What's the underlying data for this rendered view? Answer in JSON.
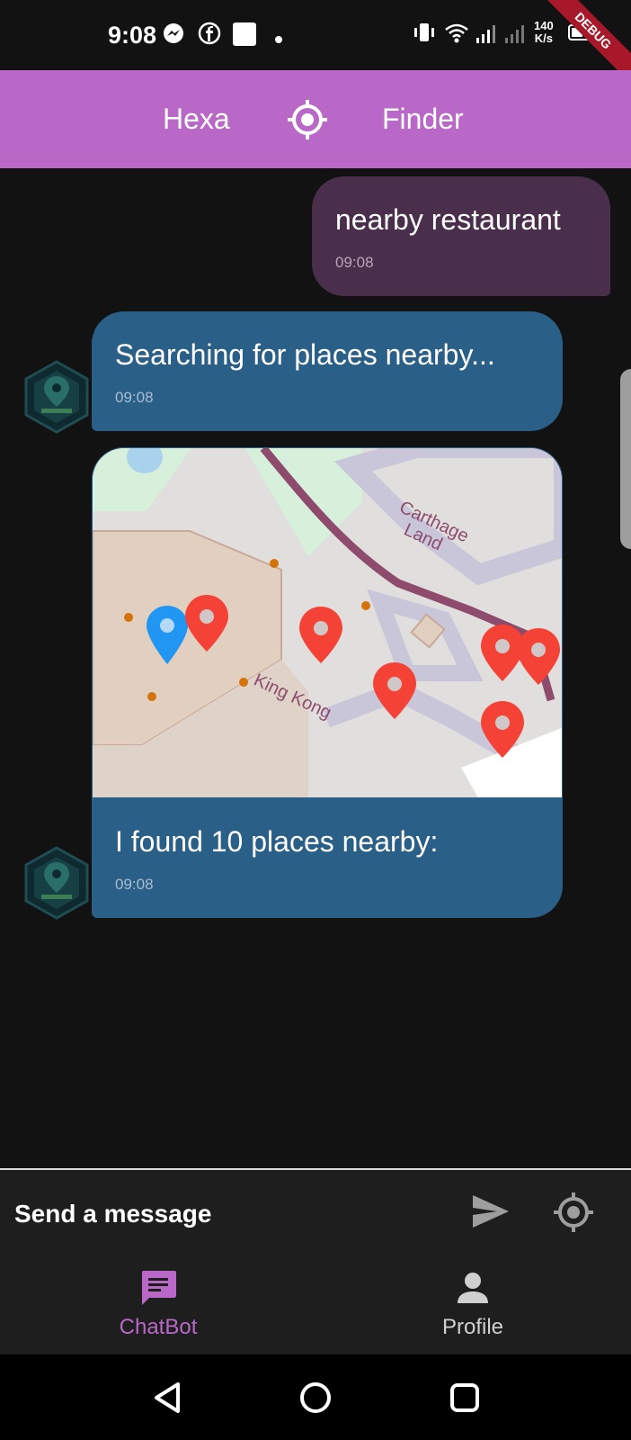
{
  "status_bar": {
    "time": "9:08",
    "speed_value": "140",
    "speed_unit": "K/s",
    "debug_banner": "DEBUG",
    "icons": [
      "messenger-icon",
      "facebook-icon",
      "square-app-icon",
      "dot-icon",
      "vibrate-icon",
      "wifi-icon",
      "signal-icon",
      "signal-icon",
      "battery-icon"
    ]
  },
  "app_bar": {
    "title_left": "Hexa",
    "title_right": "Finder",
    "icon": "gps-target-icon",
    "color": "#ba68c8"
  },
  "messages": [
    {
      "sender": "user",
      "text": "nearby restaurant",
      "time": "09:08"
    },
    {
      "sender": "bot",
      "text": "Searching for places nearby...",
      "time": "09:08"
    },
    {
      "sender": "bot",
      "text": "I found 10 places nearby:",
      "time": "09:08",
      "has_map": true
    }
  ],
  "map": {
    "labels": [
      "Carthage",
      "Land",
      "King Kong"
    ],
    "markers": {
      "user_location": 1,
      "places_visible": 7
    }
  },
  "input": {
    "placeholder": "Send a message",
    "send_icon": "send-icon",
    "location_icon": "gps-target-icon"
  },
  "bottom_nav": {
    "items": [
      {
        "label": "ChatBot",
        "icon": "chat-icon",
        "active": true
      },
      {
        "label": "Profile",
        "icon": "person-icon",
        "active": false
      }
    ],
    "active_color": "#ba68c8",
    "inactive_color": "#d0d0d0"
  },
  "system_nav": [
    "back-icon",
    "home-icon",
    "recents-icon"
  ]
}
